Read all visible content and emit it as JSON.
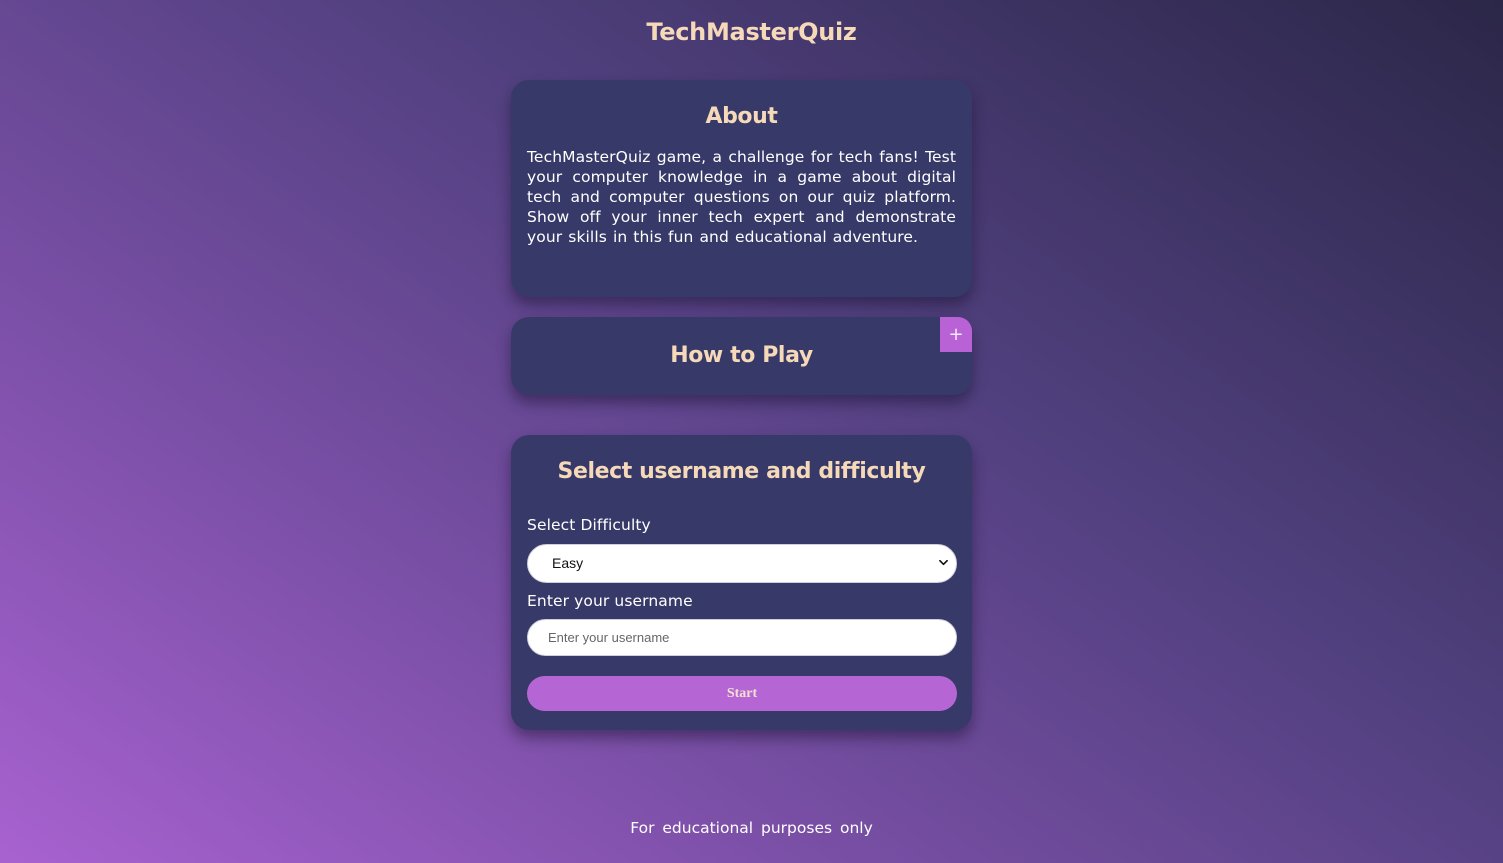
{
  "header": {
    "title": "TechMasterQuiz"
  },
  "about": {
    "title": "About",
    "text": "TechMasterQuiz game, a challenge for tech fans! Test your computer knowledge in a game about digital tech and computer questions on our quiz platform. Show off your inner tech expert and demonstrate your skills in this fun and educational adventure."
  },
  "how_to_play": {
    "title": "How to Play",
    "toggle_label": "+"
  },
  "setup": {
    "title": "Select username and difficulty",
    "difficulty_label": "Select Difficulty",
    "difficulty_value": "Easy",
    "username_label": "Enter your username",
    "username_value": "",
    "username_placeholder": "Enter your username",
    "start_label": "Start"
  },
  "footer": {
    "text": "For educational purposes only"
  },
  "colors": {
    "accent": "#b666d4",
    "card": "#373a69",
    "heading": "#f5d9b8"
  },
  "icons": {
    "select_chevron": "chevron-down-icon"
  }
}
